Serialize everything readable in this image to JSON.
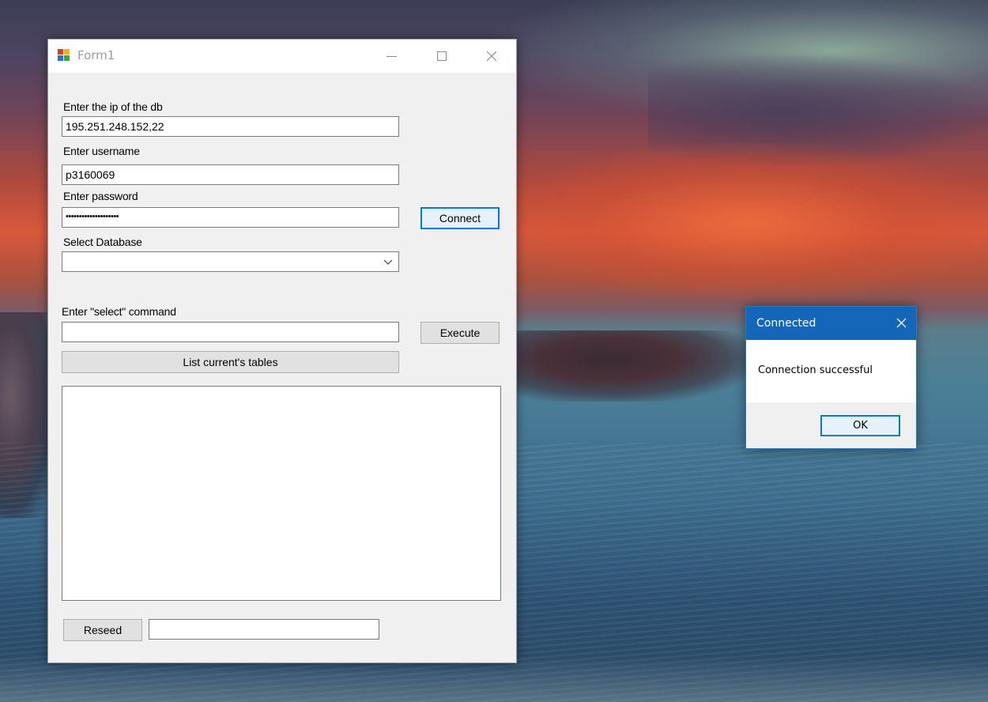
{
  "window": {
    "title": "Form1",
    "ip_label": "Enter the ip of the db",
    "ip_value": "195.251.248.152,22",
    "username_label": "Enter username",
    "username_value": "p3160069",
    "password_label": "Enter password",
    "password_masked": "••••••••••••••••••••",
    "connect_label": "Connect",
    "database_label": "Select Database",
    "database_value": "",
    "select_label": "Enter \"select\" command",
    "select_value": "",
    "execute_label": "Execute",
    "list_tables_label": "List current's tables",
    "reseed_label": "Reseed",
    "reseed_value": ""
  },
  "dialog": {
    "title": "Connected",
    "message": "Connection successful",
    "ok_label": "OK"
  },
  "icons": {
    "app": "winforms-app-icon",
    "minimize": "minimize-icon",
    "maximize": "maximize-icon",
    "close": "close-icon",
    "combo": "chevron-down-icon"
  },
  "colors": {
    "accent": "#0078d7",
    "dialog_titlebar": "#1366b8",
    "form_bg": "#f0f0f0"
  }
}
